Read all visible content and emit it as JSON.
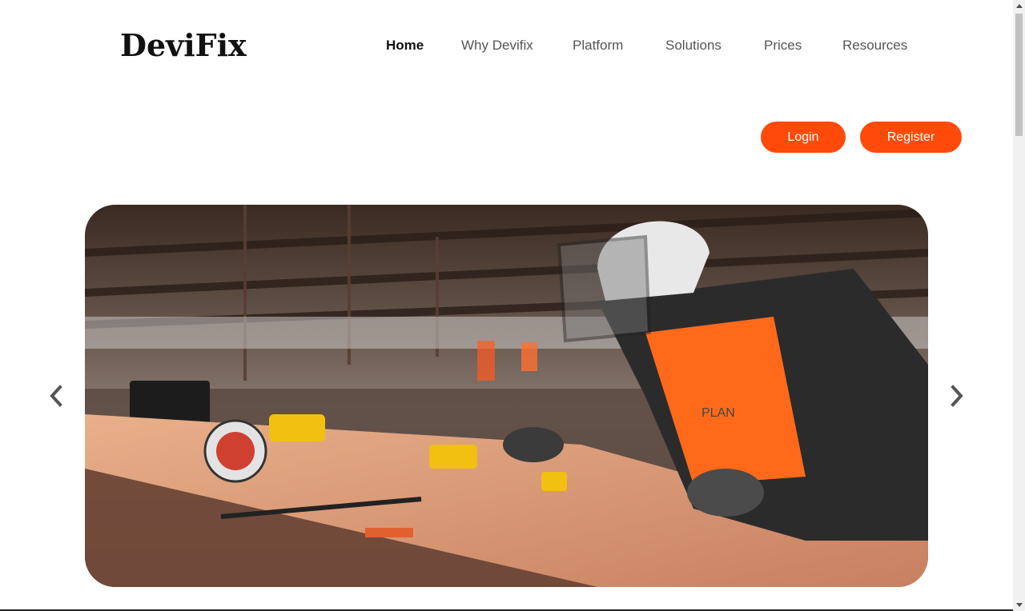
{
  "brand": {
    "name": "DeviFix"
  },
  "nav": {
    "items": [
      {
        "label": "Home",
        "active": true
      },
      {
        "label": "Why Devifix",
        "active": false
      },
      {
        "label": "Platform",
        "active": false
      },
      {
        "label": "Solutions",
        "active": false
      },
      {
        "label": "Prices",
        "active": false
      },
      {
        "label": "Resources",
        "active": false
      }
    ]
  },
  "auth": {
    "login_label": "Login",
    "register_label": "Register"
  },
  "carousel": {
    "prev_icon": "chevron-left-icon",
    "next_icon": "chevron-right-icon",
    "hero_printed_text": "PLAN"
  },
  "colors": {
    "accent": "#ff4a0a",
    "text_dark": "#111111",
    "nav_text": "#555555"
  }
}
